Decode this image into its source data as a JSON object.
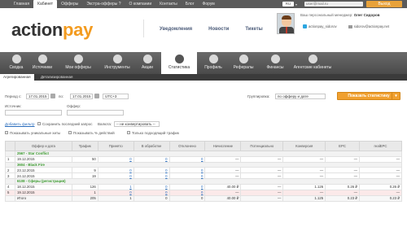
{
  "topnav": {
    "items": [
      "Главная",
      "Кабинет",
      "Офферы",
      "Экстра-офферы",
      "О компании",
      "Контакты",
      "Блог",
      "Форум"
    ],
    "active_index": 1,
    "help_icon": "question-circle-icon",
    "lang": "RU",
    "username_placeholder": "user@mail.ru",
    "logout_label": "Выход"
  },
  "header": {
    "logo_action": "action",
    "logo_pay": "pay",
    "nav": [
      "Уведомления",
      "Новости",
      "Тикеты"
    ],
    "manager_label": "Ваш персональный менеджер:",
    "manager_name": "Олег Сидоров",
    "skype": "actionpay_sidorov",
    "email": "sidorov@actionpay.net"
  },
  "tabs": [
    {
      "label": "Сводка",
      "icon": "dashboard-icon"
    },
    {
      "label": "Источники",
      "icon": "eye-icon"
    },
    {
      "label": "Мои офферы",
      "icon": "briefcase-icon"
    },
    {
      "label": "Инструменты",
      "icon": "tools-icon"
    },
    {
      "label": "Акции",
      "icon": "tag-icon"
    },
    {
      "label": "Статистика",
      "icon": "bar-chart-icon"
    },
    {
      "label": "Профиль",
      "icon": "id-card-icon"
    },
    {
      "label": "Рефералы",
      "icon": "rocket-icon"
    },
    {
      "label": "Финансы",
      "icon": "wallet-icon"
    },
    {
      "label": "Агентские кабинеты",
      "icon": "agency-icon"
    }
  ],
  "active_tab": 5,
  "subnav": {
    "s1": "Агрегированная",
    "s2": "Детализированная"
  },
  "filters": {
    "period_label": "Период с:",
    "date_from": "17.01.2015",
    "to_label": "по:",
    "date_to": "17.01.2015",
    "timezone": "UTC+3",
    "grouping_label": "Группировка:",
    "grouping_value": "по офферу и дате",
    "source_label": "Источник:",
    "offer_label": "Оффер:",
    "add_filter": "Добавить фильтр",
    "save_last": "Сохранить последний запрос",
    "currency_label": "Валюта:",
    "currency_value": "-- не конвертировать --",
    "show_unique": "Показывать уникальные хиты",
    "show_percent": "Показывать % действий",
    "show_matching": "Только подходящий трафик",
    "show_button": "Показать статистику"
  },
  "table": {
    "headers": [
      "Оффер и дата",
      "Трафик",
      "Принято",
      "В обработке",
      "Отклонено",
      "Начисление",
      "Потенциально",
      "Конверсия",
      "EPC",
      "realEPC"
    ],
    "rows": [
      {
        "kind": "grp",
        "label": "2567 - Star Conflict"
      },
      {
        "kind": "row",
        "n": "1",
        "date": "19.12.2015",
        "vals": [
          "50",
          "0",
          "0",
          "0",
          "—",
          "—",
          "—",
          "—",
          "—"
        ]
      },
      {
        "kind": "grp",
        "label": "3604 - Black Fire"
      },
      {
        "kind": "row",
        "n": "2",
        "date": "23.12.2015",
        "vals": [
          "9",
          "0",
          "0",
          "0",
          "—",
          "—",
          "—",
          "—",
          "—"
        ]
      },
      {
        "kind": "row",
        "n": "3",
        "date": "24.12.2015",
        "vals": [
          "19",
          "0",
          "0",
          "0",
          "—",
          "—",
          "—",
          "—",
          "—"
        ]
      },
      {
        "kind": "grp",
        "label": "6108 - Сферы (регистрация)"
      },
      {
        "kind": "row",
        "n": "4",
        "date": "18.12.2015",
        "vals": [
          "126",
          "1",
          "0",
          "0",
          "40.00 ₽",
          "—",
          "1.126",
          "0.26 ₽",
          "0.26 ₽"
        ]
      },
      {
        "kind": "rred",
        "n": "5",
        "date": "19.12.2015",
        "vals": [
          "1",
          "0",
          "0",
          "0",
          "—",
          "—",
          "—",
          "—",
          "—"
        ]
      },
      {
        "kind": "tot",
        "n": "",
        "date": "Итого",
        "vals": [
          "205",
          "1",
          "0",
          "0",
          "40.00 ₽",
          "—",
          "1.125",
          "0.23 ₽",
          "0.23 ₽"
        ]
      }
    ]
  }
}
